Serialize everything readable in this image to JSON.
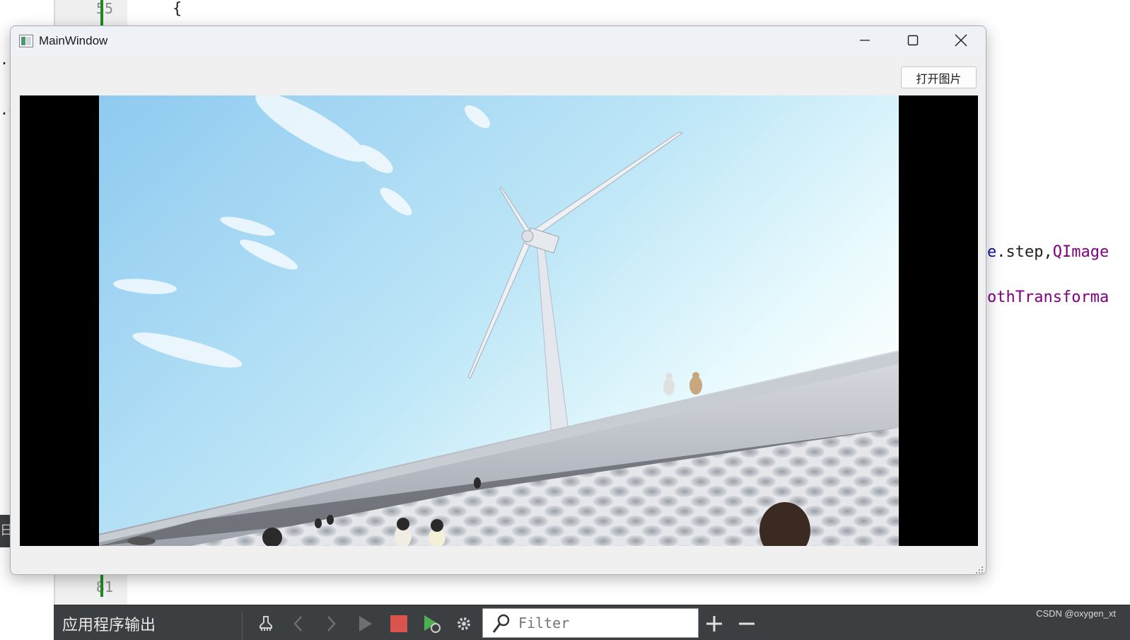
{
  "ide": {
    "left_fragments": [
      ".c",
      ".u"
    ],
    "left_edge_text": "日",
    "line_numbers": {
      "top": "55",
      "bottom": "81"
    },
    "code_brace": "{",
    "code_fragment_step": [
      {
        "text": "e",
        "color": "#1010a0"
      },
      {
        "text": ".step,",
        "color": "#202020"
      },
      {
        "text": "QImage",
        "color": "#800080"
      }
    ],
    "code_fragment_smooth": "othTransforma",
    "gutter_mark_color": "#1f8a1f"
  },
  "output_pane": {
    "title": "应用程序输出",
    "buttons": [
      {
        "name": "clear-icon"
      },
      {
        "name": "chevron-left-icon"
      },
      {
        "name": "chevron-right-icon"
      },
      {
        "name": "run-icon"
      },
      {
        "name": "stop-icon",
        "color": "#d9534f"
      },
      {
        "name": "rerun-icon",
        "color": "#4caf50"
      },
      {
        "name": "gear-icon"
      }
    ],
    "filter_placeholder": "Filter",
    "zoom_in_icon": "plus-icon",
    "zoom_out_icon": "minus-icon"
  },
  "watermark": "CSDN @oxygen_xt",
  "window": {
    "title": "MainWindow",
    "controls": [
      "minimize-icon",
      "maximize-icon",
      "close-icon"
    ],
    "open_image_label": "打开图片",
    "image_description_alt": "wind turbine photo"
  },
  "colors": {
    "title_bar": "#eef1f6",
    "window_bg": "#f0f0f0",
    "output_bar": "#3c3f41",
    "image_frame": "#000000"
  }
}
